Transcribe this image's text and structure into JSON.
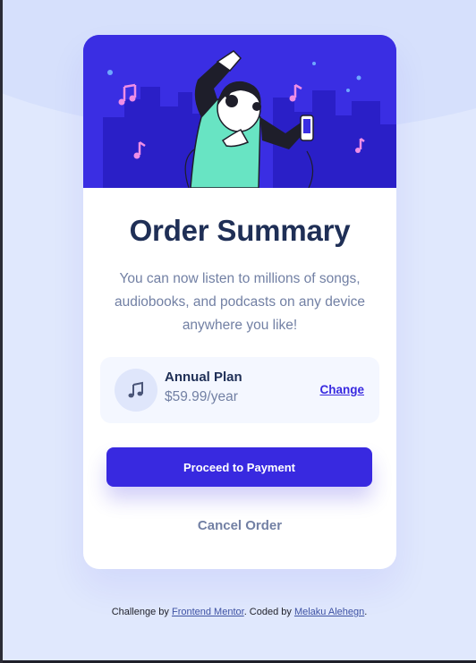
{
  "colors": {
    "background": "#e0e8fd",
    "hero_background": "#3a2ee3",
    "primary": "#3829e0",
    "title": "#1f2f56",
    "muted": "#7280a4",
    "plan_background": "#f4f7ff"
  },
  "hero": {
    "illustration": "woman-dancing-with-headphones-city-skyline-illustration"
  },
  "card": {
    "title": "Order Summary",
    "description": "You can now listen to millions of songs, audiobooks, and podcasts on any device anywhere you like!",
    "plan": {
      "icon": "music-note-icon",
      "name": "Annual Plan",
      "price": "$59.99/year",
      "change_label": "Change"
    },
    "proceed_label": "Proceed to Payment",
    "cancel_label": "Cancel Order"
  },
  "footer": {
    "prefix": "Challenge by ",
    "challenge_link": "Frontend Mentor",
    "middle": ". Coded by ",
    "author_link": "Melaku Alehegn",
    "suffix": "."
  }
}
